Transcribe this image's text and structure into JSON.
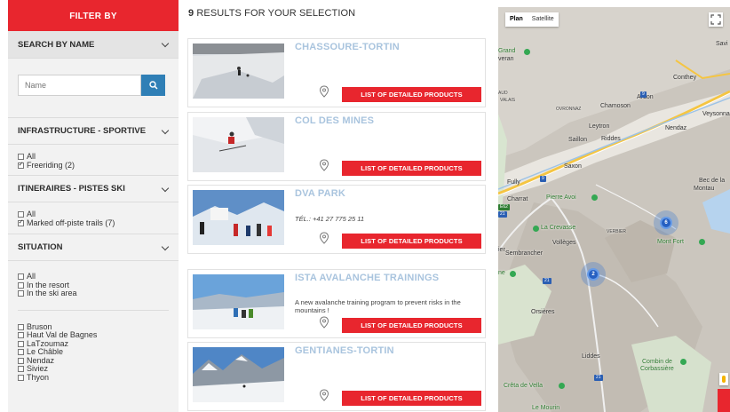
{
  "sidebar": {
    "header": "FILTER BY",
    "search": {
      "title": "SEARCH BY NAME",
      "placeholder": "Name"
    },
    "infrastructure": {
      "title": "INFRASTRUCTURE - SPORTIVE",
      "options": [
        {
          "label": "All",
          "checked": false
        },
        {
          "label": "Freeriding (2)",
          "checked": true
        }
      ]
    },
    "itineraries": {
      "title": "ITINERAIRES - PISTES SKI",
      "options": [
        {
          "label": "All",
          "checked": false
        },
        {
          "label": "Marked off-piste trails (7)",
          "checked": true
        }
      ]
    },
    "situation": {
      "title": "SITUATION",
      "options": [
        {
          "label": "All",
          "checked": false
        },
        {
          "label": "In the resort",
          "checked": false
        },
        {
          "label": "In the ski area",
          "checked": false
        }
      ]
    },
    "places": [
      {
        "label": "Bruson",
        "checked": false
      },
      {
        "label": "Haut Val de Bagnes",
        "checked": false
      },
      {
        "label": "LaTzoumaz",
        "checked": false
      },
      {
        "label": "Le Châble",
        "checked": false
      },
      {
        "label": "Nendaz",
        "checked": false
      },
      {
        "label": "Siviez",
        "checked": false
      },
      {
        "label": "Thyon",
        "checked": false
      }
    ]
  },
  "results": {
    "count": "9",
    "label": " RESULTS FOR YOUR SELECTION",
    "button_label": "LIST OF DETAILED PRODUCTS",
    "items": [
      {
        "name": "CHASSOURE-TORTIN",
        "tel": "",
        "desc": ""
      },
      {
        "name": "COL DES MINES",
        "tel": "",
        "desc": ""
      },
      {
        "name": "DVA PARK",
        "tel": "TÉL.: +41 27 775 25 11",
        "desc": ""
      },
      {
        "name": "ISTA AVALANCHE TRAININGS",
        "tel": "",
        "desc": "A new avalanche training program to prevent risks in the mountains !"
      },
      {
        "name": "GENTIANES-TORTIN",
        "tel": "",
        "desc": ""
      }
    ]
  },
  "map": {
    "type_plan": "Plan",
    "type_satellite": "Satellite",
    "labels": {
      "grand_veran": "Grand",
      "grand_veran2": "veran",
      "savi": "Savi",
      "conthey": "Conthey",
      "ardon": "Ardon",
      "chamoson": "Chamoson",
      "ovronnaz": "OVRONNAZ",
      "veysonna": "Veysonna",
      "leytron": "Leytron",
      "nendaz": "Nendaz",
      "saillon": "Saillon",
      "riddes": "Riddes",
      "saxon": "Saxon",
      "fully": "Fully",
      "bec": "Bec de la",
      "montau": "Montau",
      "charrat": "Charrat",
      "pierre_avoi": "Pierre Avoi",
      "la_crevasse": "La Crevasse",
      "verbier": "VERBIER",
      "volleges": "Vollèges",
      "sembrancher": "Sembrancher",
      "mont_fort": "Mont Fort",
      "orsieres": "Orsières",
      "liddes": "Liddes",
      "combin": "Combin de",
      "corbassiere": "Corbassière",
      "creta": "Crêta de Vella",
      "mourin": "Le Mourin",
      "aud": "AUD",
      "valais": "VALAIS",
      "ier": "ier",
      "ne": "ne"
    },
    "clusters": [
      "6",
      "2"
    ],
    "shields": [
      "9",
      "9",
      "E62",
      "21",
      "21",
      "21"
    ]
  }
}
